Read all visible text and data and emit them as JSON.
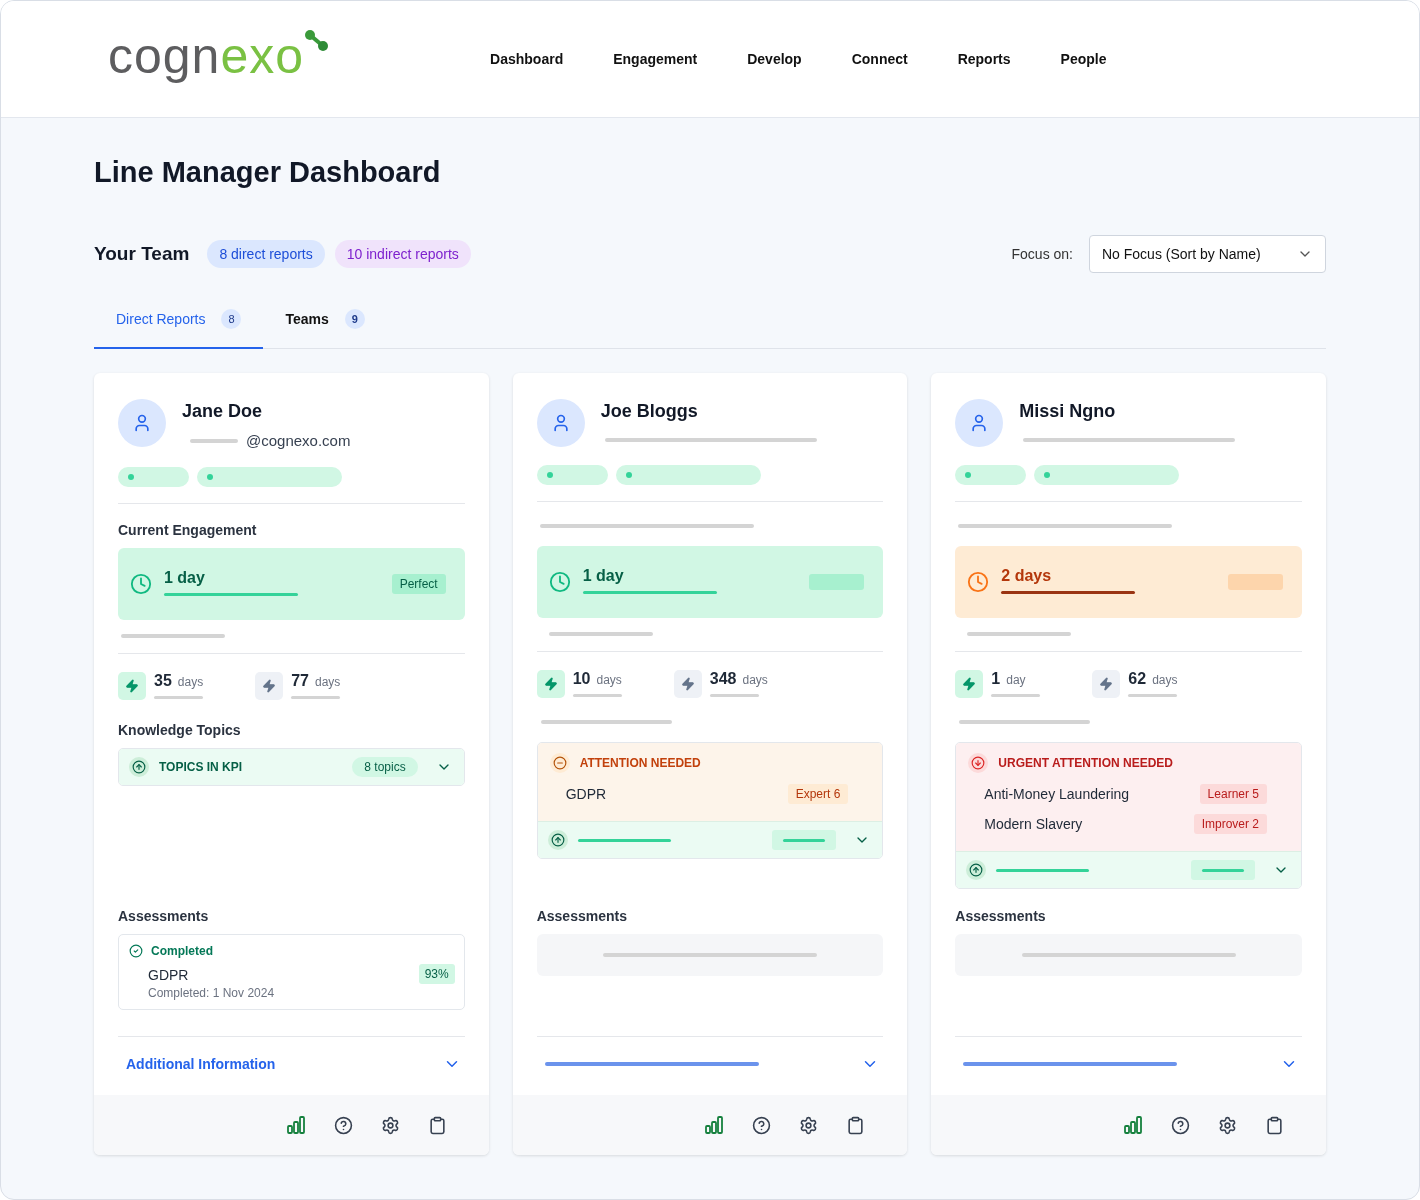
{
  "logo": {
    "main": "cogn",
    "accent": "exo"
  },
  "nav": [
    {
      "label": "Dashboard"
    },
    {
      "label": "Engagement"
    },
    {
      "label": "Develop"
    },
    {
      "label": "Connect"
    },
    {
      "label": "Reports"
    },
    {
      "label": "People"
    }
  ],
  "page_title": "Line Manager Dashboard",
  "team": {
    "title": "Your Team",
    "direct_badge": "8 direct reports",
    "indirect_badge": "10 indirect reports"
  },
  "focus": {
    "label": "Focus on:",
    "value": "No Focus (Sort by Name)"
  },
  "tabs": [
    {
      "label": "Direct Reports",
      "count": "8",
      "selected": true
    },
    {
      "label": "Teams",
      "count": "9",
      "selected": false
    }
  ],
  "cards": [
    {
      "name": "Jane Doe",
      "email": "@cognexo.com",
      "engagement_label": "Current Engagement",
      "engagement": {
        "kind": "good",
        "value": "1 day",
        "badge": "Perfect"
      },
      "stats": [
        {
          "value": "35",
          "unit": "days",
          "kind": "green"
        },
        {
          "value": "77",
          "unit": "days",
          "kind": "grey"
        }
      ],
      "topics_label": "Knowledge Topics",
      "kpi": {
        "label": "TOPICS IN KPI",
        "count": "8 topics"
      },
      "assessments_label": "Assessments",
      "assessment": {
        "status": "Completed",
        "name": "GDPR",
        "date": "Completed: 1 Nov 2024",
        "score": "93%"
      },
      "additional": "Additional Information"
    },
    {
      "name": "Joe Bloggs",
      "engagement": {
        "kind": "good",
        "value": "1 day"
      },
      "stats": [
        {
          "value": "10",
          "unit": "days",
          "kind": "green"
        },
        {
          "value": "348",
          "unit": "days",
          "kind": "grey"
        }
      ],
      "alert": {
        "kind": "attention",
        "heading": "ATTENTION NEEDED",
        "items": [
          {
            "name": "GDPR",
            "badge": "Expert 6"
          }
        ]
      },
      "kpi_loading": true,
      "assessments_label": "Assessments"
    },
    {
      "name": "Missi Ngno",
      "engagement": {
        "kind": "warning",
        "value": "2 days"
      },
      "stats": [
        {
          "value": "1",
          "unit": "day",
          "kind": "green"
        },
        {
          "value": "62",
          "unit": "days",
          "kind": "grey"
        }
      ],
      "alert": {
        "kind": "urgent",
        "heading": "URGENT ATTENTION NEEDED",
        "items": [
          {
            "name": "Anti-Money Laundering",
            "badge": "Learner 5"
          },
          {
            "name": "Modern Slavery",
            "badge": "Improver 2"
          }
        ]
      },
      "kpi_loading": true,
      "assessments_label": "Assessments"
    }
  ]
}
